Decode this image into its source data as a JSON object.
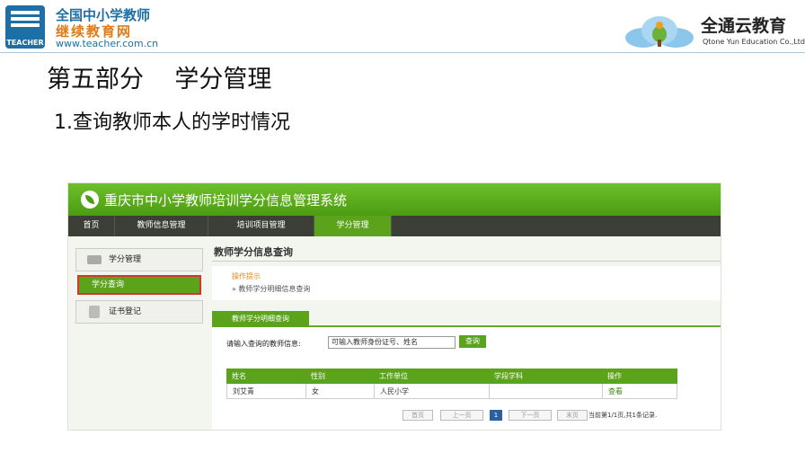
{
  "logo_left": {
    "badge_text": "TEACHER",
    "line1": "全国中小学教师",
    "line2": "继续教育网",
    "url": "www.teacher.com.cn"
  },
  "logo_right": {
    "name_cn": "全通云教育",
    "name_en": "Qtone Yun Education Co.,Ltd"
  },
  "slide": {
    "title": "第五部分    学分管理",
    "subtitle": "1.查询教师本人的学时情况"
  },
  "system": {
    "title": "重庆市中小学教师培训学分信息管理系统",
    "nav": [
      "首页",
      "教师信息管理",
      "培训项目管理",
      "学分管理"
    ],
    "active_nav": "学分管理",
    "sidebar": {
      "group1": "学分管理",
      "sub_item": "学分查询",
      "group2": "证书登记"
    },
    "page_heading": "教师学分信息查询",
    "tip_title": "操作提示",
    "tip_text": "教师学分明细信息查询",
    "tab": "教师学分明细查询",
    "query_label": "请输入查询的教师信息:",
    "query_placeholder": "可输入教师身份证号、姓名",
    "query_button": "查询",
    "table": {
      "headers": [
        "姓名",
        "性别",
        "工作单位",
        "学段学科",
        "操作"
      ],
      "rows": [
        [
          "刘艾青",
          "女",
          "人民小学",
          "",
          "查看"
        ]
      ]
    },
    "pager": {
      "first": "首页",
      "prev": "上一页",
      "current": "1",
      "next": "下一页",
      "last": "末页",
      "info": "当前第1/1页,共1条记录."
    }
  },
  "colors": {
    "green": "#5aa31b",
    "nav_dark": "#3b3f36",
    "brand_blue": "#1d6fa5",
    "brand_orange": "#e07b18",
    "highlight_red": "#d9342b"
  }
}
